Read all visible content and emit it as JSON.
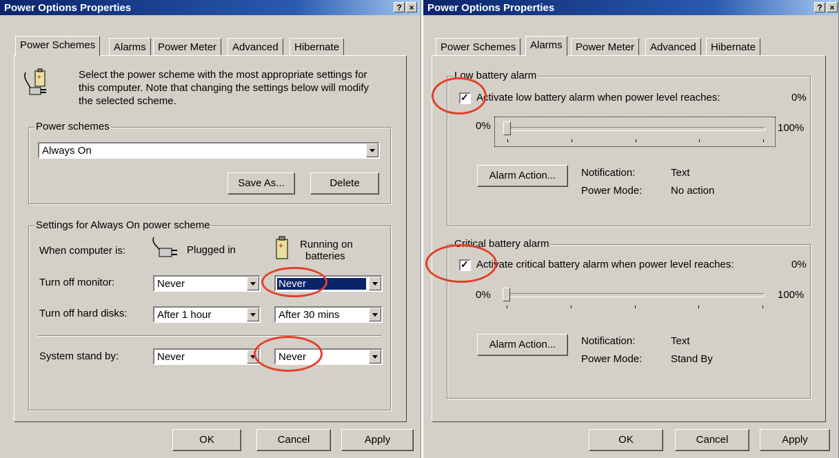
{
  "colors": {
    "title_bar": "#0a246a",
    "highlight": "#0a246a",
    "annotation_circle": "#e2412a",
    "dialog_bg": "#d4d0c8"
  },
  "left": {
    "title": "Power Options Properties",
    "help_button": "?",
    "close_button": "×",
    "tabs": [
      "Power Schemes",
      "Alarms",
      "Power Meter",
      "Advanced",
      "Hibernate"
    ],
    "active_tab": "Power Schemes",
    "description": [
      "Select the power scheme with the most appropriate settings for",
      "this computer. Note that changing the settings below will modify",
      "the selected scheme."
    ],
    "power_schemes": {
      "group_label": "Power schemes",
      "selected": "Always On",
      "save_as": "Save As...",
      "delete": "Delete"
    },
    "settings": {
      "group_label": "Settings for Always On power scheme",
      "when_label": "When computer is:",
      "plugged_in": "Plugged in",
      "running_on": "Running on",
      "batteries": "batteries",
      "rows": [
        {
          "label": "Turn off monitor:",
          "plugged": "Never",
          "battery": "Never"
        },
        {
          "label": "Turn off hard disks:",
          "plugged": "After 1 hour",
          "battery": "After 30 mins"
        },
        {
          "label": "System stand by:",
          "plugged": "Never",
          "battery": "Never"
        }
      ]
    },
    "buttons": {
      "ok": "OK",
      "cancel": "Cancel",
      "apply": "Apply"
    }
  },
  "right": {
    "title": "Power Options Properties",
    "help_button": "?",
    "close_button": "×",
    "tabs": [
      "Power Schemes",
      "Alarms",
      "Power Meter",
      "Advanced",
      "Hibernate"
    ],
    "active_tab": "Alarms",
    "low": {
      "group_label": "Low battery alarm",
      "checkbox_label": "Activate low battery alarm when power level reaches:",
      "checked": true,
      "percent": "0%",
      "min_label": "0%",
      "max_label": "100%",
      "level": 0,
      "action_button": "Alarm Action...",
      "notification_label": "Notification:",
      "notification_value": "Text",
      "power_mode_label": "Power Mode:",
      "power_mode_value": "No action"
    },
    "critical": {
      "group_label": "Critical battery alarm",
      "checkbox_label": "Activate critical battery alarm when power level reaches:",
      "checked": true,
      "percent": "0%",
      "min_label": "0%",
      "max_label": "100%",
      "level": 0,
      "action_button": "Alarm Action...",
      "notification_label": "Notification:",
      "notification_value": "Text",
      "power_mode_label": "Power Mode:",
      "power_mode_value": "Stand By"
    },
    "buttons": {
      "ok": "OK",
      "cancel": "Cancel",
      "apply": "Apply"
    }
  }
}
